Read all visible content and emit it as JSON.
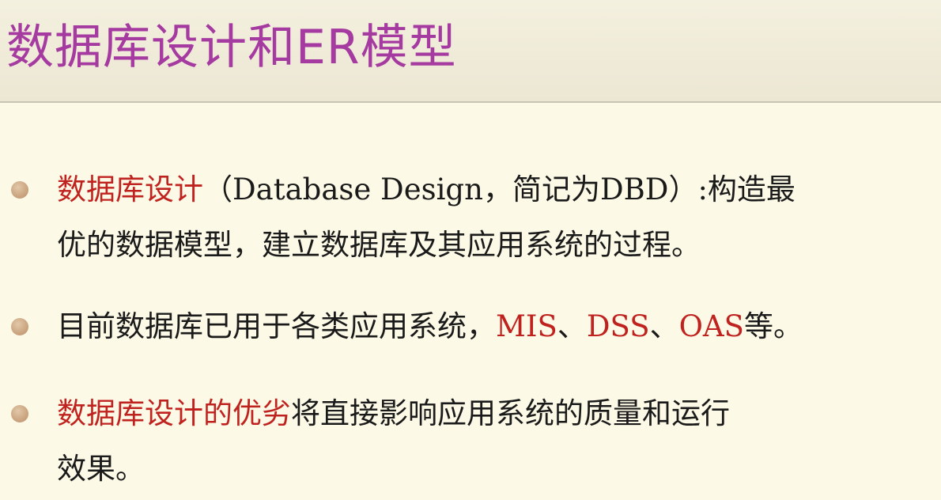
{
  "slide": {
    "title": "数据库设计和ER模型",
    "bullets": [
      {
        "line1": {
          "highlight": "数据库设计",
          "rest": "（Database Design，简记为DBD）:构造最"
        },
        "line2": "优的数据模型，建立数据库及其应用系统的过程。"
      },
      {
        "line1": {
          "text_start": "目前数据库已用于各类应用系统，",
          "red_1": "MIS",
          "sep_1": "、",
          "red_2": "DSS",
          "sep_2": "、",
          "red_3": "OAS",
          "text_end": "等。"
        }
      },
      {
        "line1": {
          "highlight": "数据库设计的优劣",
          "rest": "将直接影响应用系统的质量和运行"
        },
        "line2": "效果。"
      }
    ]
  },
  "colors": {
    "title": "#a53aa0",
    "highlight": "#c0231f",
    "text": "#1a1a1a",
    "bullet": "#c79f7a",
    "background": "#fbf8e3"
  }
}
